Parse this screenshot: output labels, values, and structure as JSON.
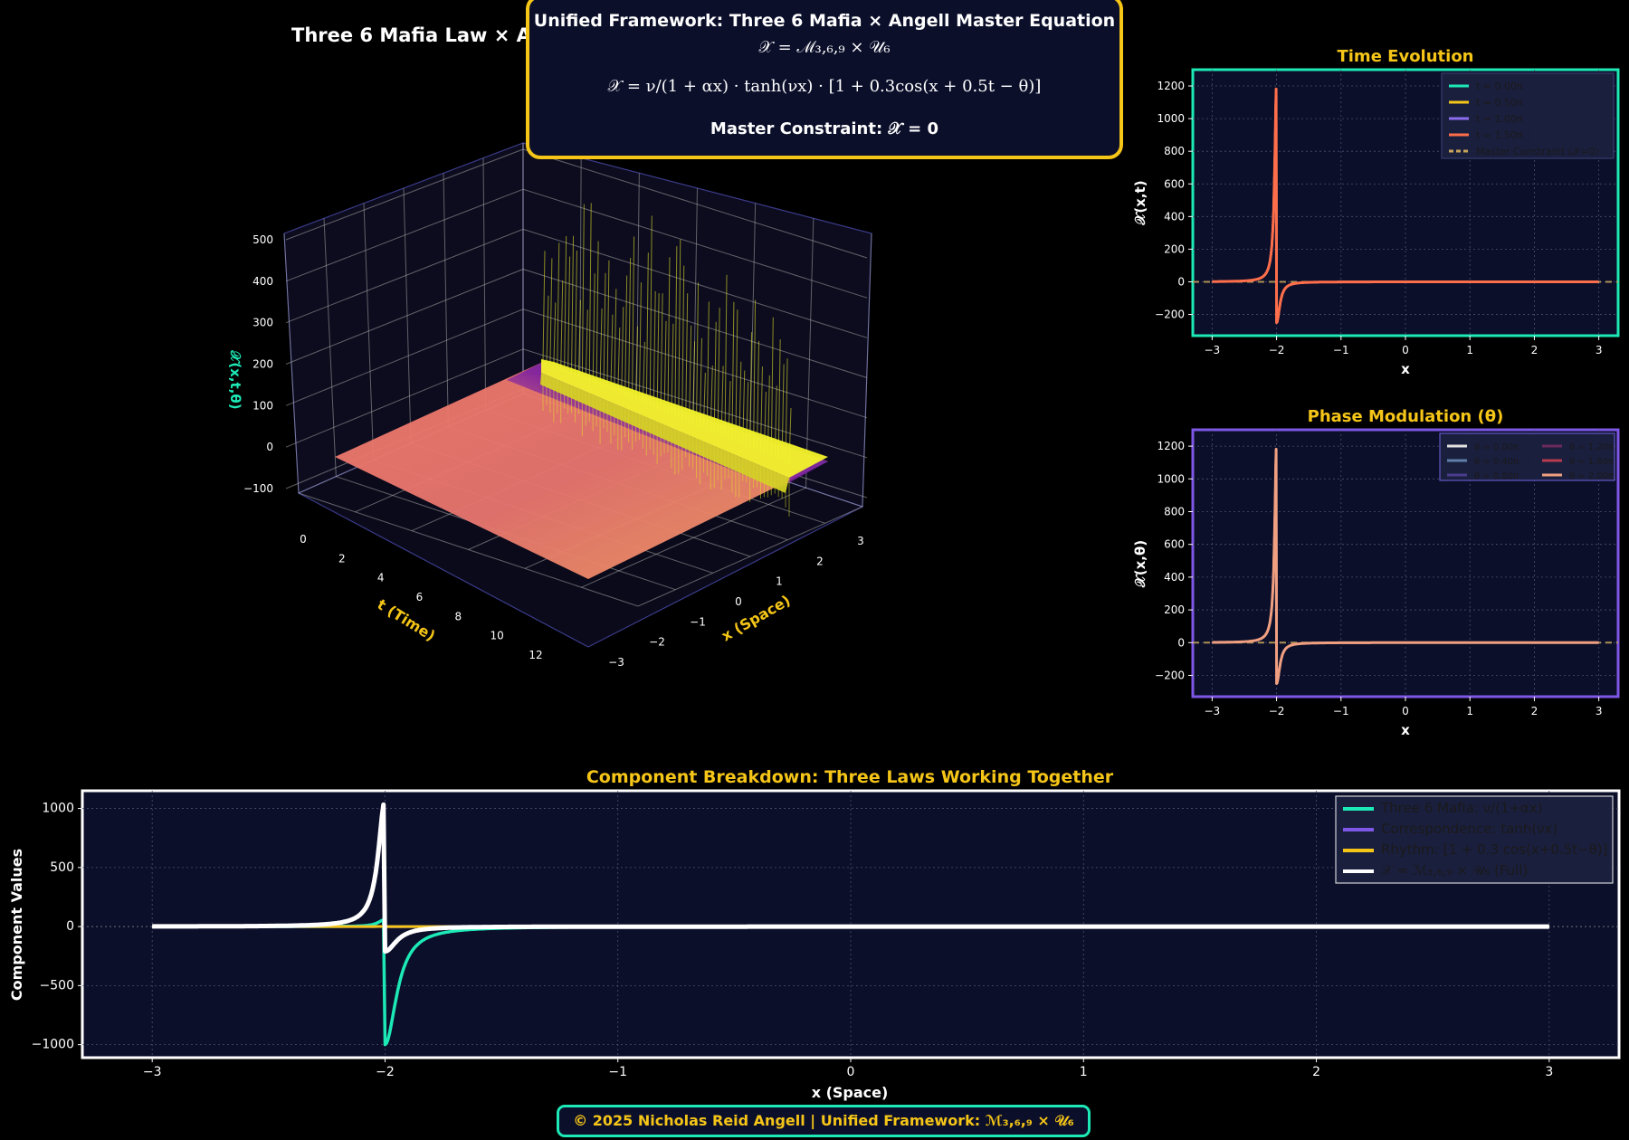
{
  "page": {
    "main_title": "Three 6 Mafia Law × Angell Unified Master Equation",
    "footer_text": "© 2025 Nicholas Reid Angell | Unified Framework: ℳ₃,₆,₉ × 𝒰₆"
  },
  "info_box": {
    "header": "Unified Framework: Three 6 Mafia × Angell Master Equation",
    "equation1": "𝒳 = ℳ₃,₆,₉ × 𝒰₆",
    "equation2": "𝒳 = ν/(1 + αx) · tanh(νx) · [1 + 0.3cos(x + 0.5t − θ)]",
    "constraint": "Master Constraint: 𝒳 = 0"
  },
  "colors": {
    "background": "#000000",
    "panel_bg": "#0b0f2a",
    "accent_yellow": "#f5c518",
    "accent_teal": "#1de9b6",
    "accent_purple": "#7e57e6",
    "white": "#ffffff"
  },
  "chart_data": [
    {
      "type": "surface3d",
      "title": "",
      "xlabel": "x (Space)",
      "ylabel": "t (Time)",
      "zlabel": "𝒳(x,t,θ)",
      "x_ticks": [
        -3,
        -2,
        -1,
        0,
        1,
        2,
        3
      ],
      "t_ticks": [
        0,
        2,
        4,
        6,
        8,
        10,
        12
      ],
      "z_ticks": [
        -100,
        0,
        100,
        200,
        300,
        400,
        500
      ],
      "xlim": [
        -3,
        3
      ],
      "tlim": [
        0,
        12.6
      ],
      "zlim": [
        -100,
        500
      ],
      "colormap": "plasma",
      "grid": true
    },
    {
      "type": "line",
      "title": "Time Evolution",
      "xlabel": "x",
      "ylabel": "𝒳(x,t)",
      "xlim": [
        -3.3,
        3.3
      ],
      "ylim": [
        -330,
        1300
      ],
      "x_ticks": [
        -3,
        -2,
        -1,
        0,
        1,
        2,
        3
      ],
      "y_ticks": [
        -200,
        0,
        200,
        400,
        600,
        800,
        1000,
        1200
      ],
      "legend_position": "upper right",
      "border_color": "#1de9b6",
      "series": [
        {
          "name": "t = 0.00π",
          "color": "#1de9b6",
          "peak": 1225,
          "trough": -250
        },
        {
          "name": "t = 0.50π",
          "color": "#f5c518",
          "peak": 1225,
          "trough": -250
        },
        {
          "name": "t = 1.00π",
          "color": "#8e6cf0",
          "peak": 1225,
          "trough": -250
        },
        {
          "name": "t = 1.50π",
          "color": "#ff6e4a",
          "peak": 1225,
          "trough": -250
        }
      ],
      "reference_line": {
        "name": "Master Constraint (𝒳=0)",
        "y": 0,
        "color": "#c8a55a"
      }
    },
    {
      "type": "line",
      "title": "Phase Modulation (θ)",
      "xlabel": "x",
      "ylabel": "𝒳(x,θ)",
      "xlim": [
        -3.3,
        3.3
      ],
      "ylim": [
        -330,
        1300
      ],
      "x_ticks": [
        -3,
        -2,
        -1,
        0,
        1,
        2,
        3
      ],
      "y_ticks": [
        -200,
        0,
        200,
        400,
        600,
        800,
        1000,
        1200
      ],
      "legend_position": "upper right",
      "border_color": "#7e57e6",
      "series": [
        {
          "name": "θ = 0.00π",
          "color": "#e0e0e0",
          "peak": 1225,
          "trough": -250
        },
        {
          "name": "θ = 0.40π",
          "color": "#5f7fa8",
          "peak": 1225,
          "trough": -250
        },
        {
          "name": "θ = 0.80π",
          "color": "#4a3c8c",
          "peak": 1225,
          "trough": -250
        },
        {
          "name": "θ = 1.20π",
          "color": "#6b2a5a",
          "peak": 1225,
          "trough": -250
        },
        {
          "name": "θ = 1.60π",
          "color": "#b83a4e",
          "peak": 1225,
          "trough": -250
        },
        {
          "name": "θ = 2.00π",
          "color": "#f0a080",
          "peak": 1225,
          "trough": -250
        }
      ],
      "reference_line": {
        "name": "",
        "y": 0,
        "color": "#c8a55a"
      }
    },
    {
      "type": "line",
      "title": "Component Breakdown: Three Laws Working Together",
      "xlabel": "x (Space)",
      "ylabel": "Component Values",
      "xlim": [
        -3.3,
        3.3
      ],
      "ylim": [
        -1110,
        1150
      ],
      "x_ticks": [
        -3,
        -2,
        -1,
        0,
        1,
        2,
        3
      ],
      "y_ticks": [
        -1000,
        -500,
        0,
        500,
        1000
      ],
      "legend_position": "upper right",
      "border_color": "#ffffff",
      "series": [
        {
          "name": "Three 6 Mafia: ν/(1+αx)",
          "color": "#1de9b6",
          "peak": 60,
          "trough": -1000
        },
        {
          "name": "Correspondence: tanh(νx)",
          "color": "#7e57e6",
          "peak": 1,
          "trough": -1
        },
        {
          "name": "Rhythm: [1 + 0.3 cos(x+0.5t−θ)]",
          "color": "#f5c518",
          "peak": 1.3,
          "trough": 0.7
        },
        {
          "name": "𝒳 = ℳ₃,₆,₉ × 𝒰₆ (Full)",
          "color": "#ffffff",
          "peak": 1070,
          "trough": -210
        }
      ]
    }
  ]
}
